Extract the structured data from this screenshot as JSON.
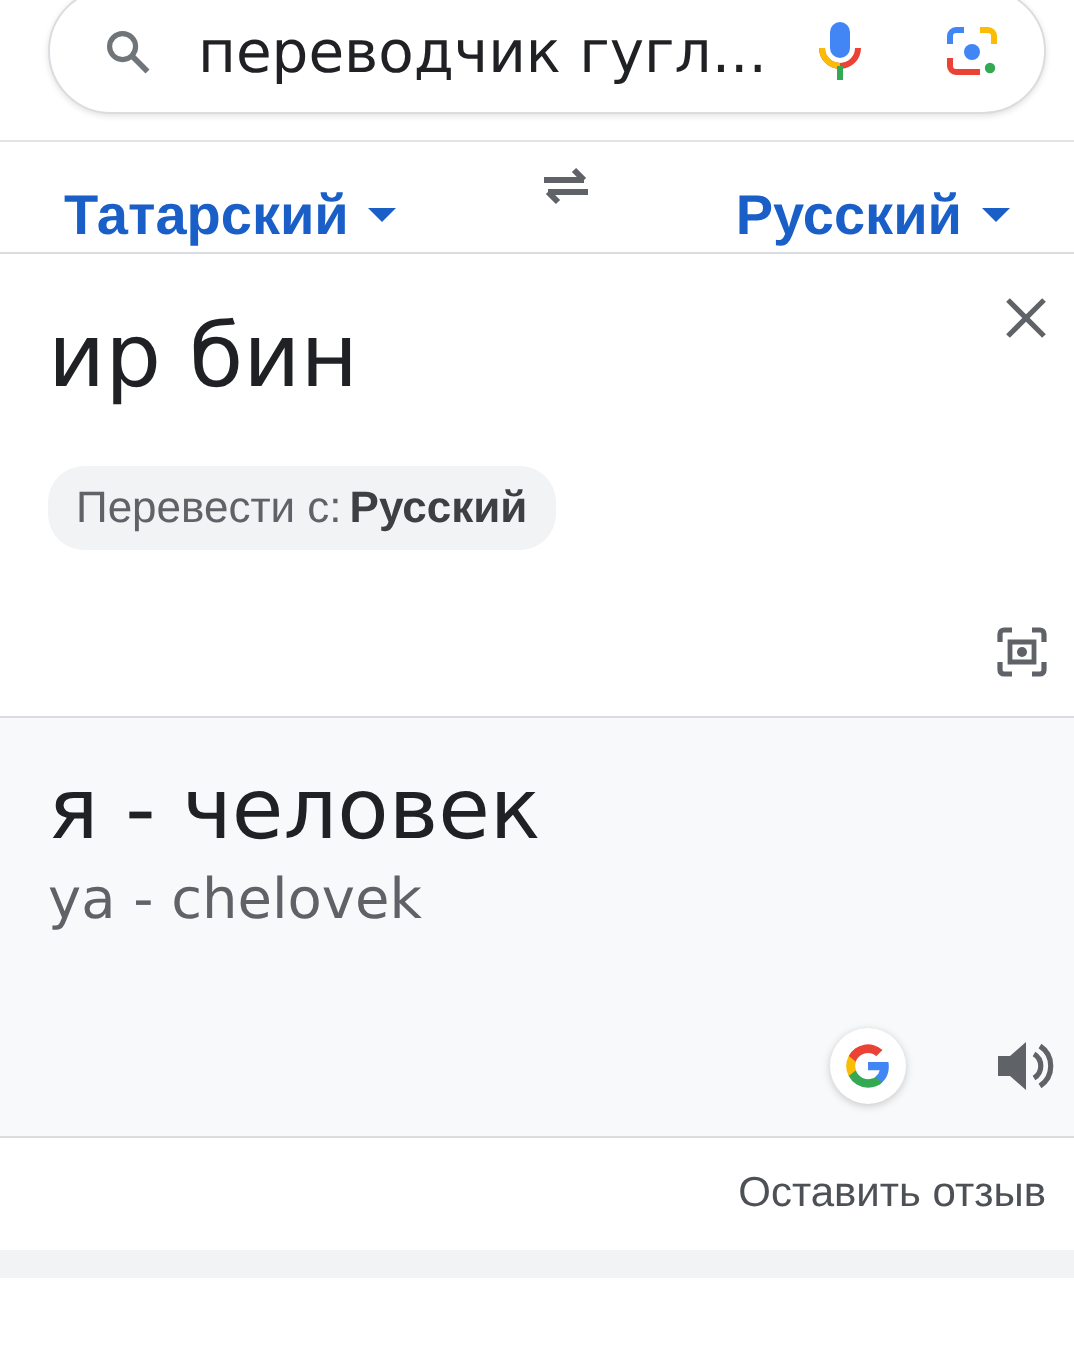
{
  "search": {
    "query": "переводчик гугл..."
  },
  "languages": {
    "source": "Татарский",
    "target": "Русский"
  },
  "input": {
    "text": "ир бин",
    "detect_label": "Перевести с:",
    "detect_value": "Русский"
  },
  "output": {
    "text": "я - человек",
    "transliteration": "ya - chelovek"
  },
  "feedback": "Оставить отзыв"
}
